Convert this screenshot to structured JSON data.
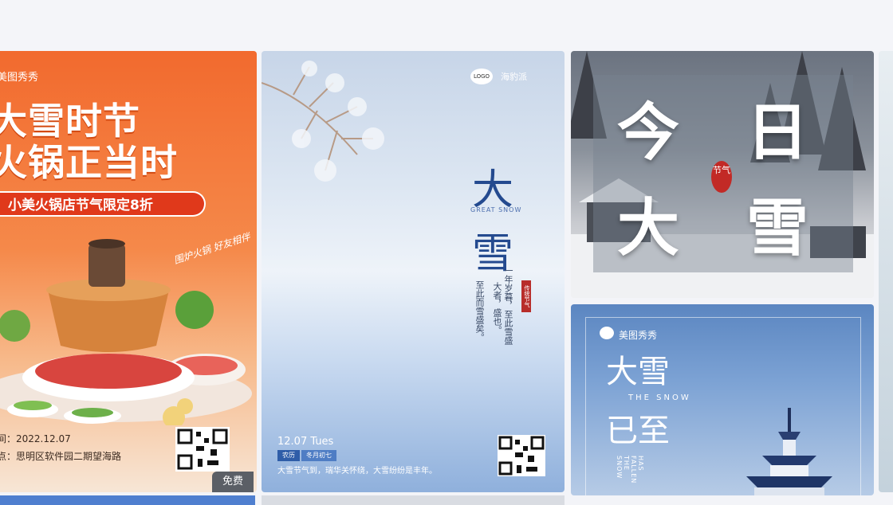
{
  "cards": [
    {
      "brand": "美图秀秀",
      "title_line1": "大雪时节",
      "title_line2": "火锅正当时",
      "band": "小美火锅店节气限定8折",
      "handwriting": "围炉火锅 好友相伴",
      "date_line": "间：2022.12.07",
      "address_line": "点：思明区软件园二期望海路",
      "badge": "免费"
    },
    {
      "logo": "LOGO",
      "brand": "海豹派",
      "big1": "大",
      "big2": "雪",
      "english": "GREAT SNOW",
      "vert_left": "至此而雪盛矣。",
      "vert_mid": "大者，盛也。",
      "vert_right": "一年岁暮，至此雪盛",
      "seal": "传统节气",
      "date": "12.07 Tues",
      "tag1": "农历",
      "tag2": "冬月初七",
      "bottom_text": "大雪节气到，瑞华关怀绕，大雪纷纷是丰年。"
    },
    {
      "char1": "今",
      "char2": "日",
      "char3": "大",
      "char4": "雪",
      "seal": "节气"
    },
    {
      "brand": "美图秀秀",
      "t1": "大雪",
      "t2": "已至",
      "english": "THE SNOW",
      "vert": "HAS FALLEN THE SNOW"
    }
  ]
}
